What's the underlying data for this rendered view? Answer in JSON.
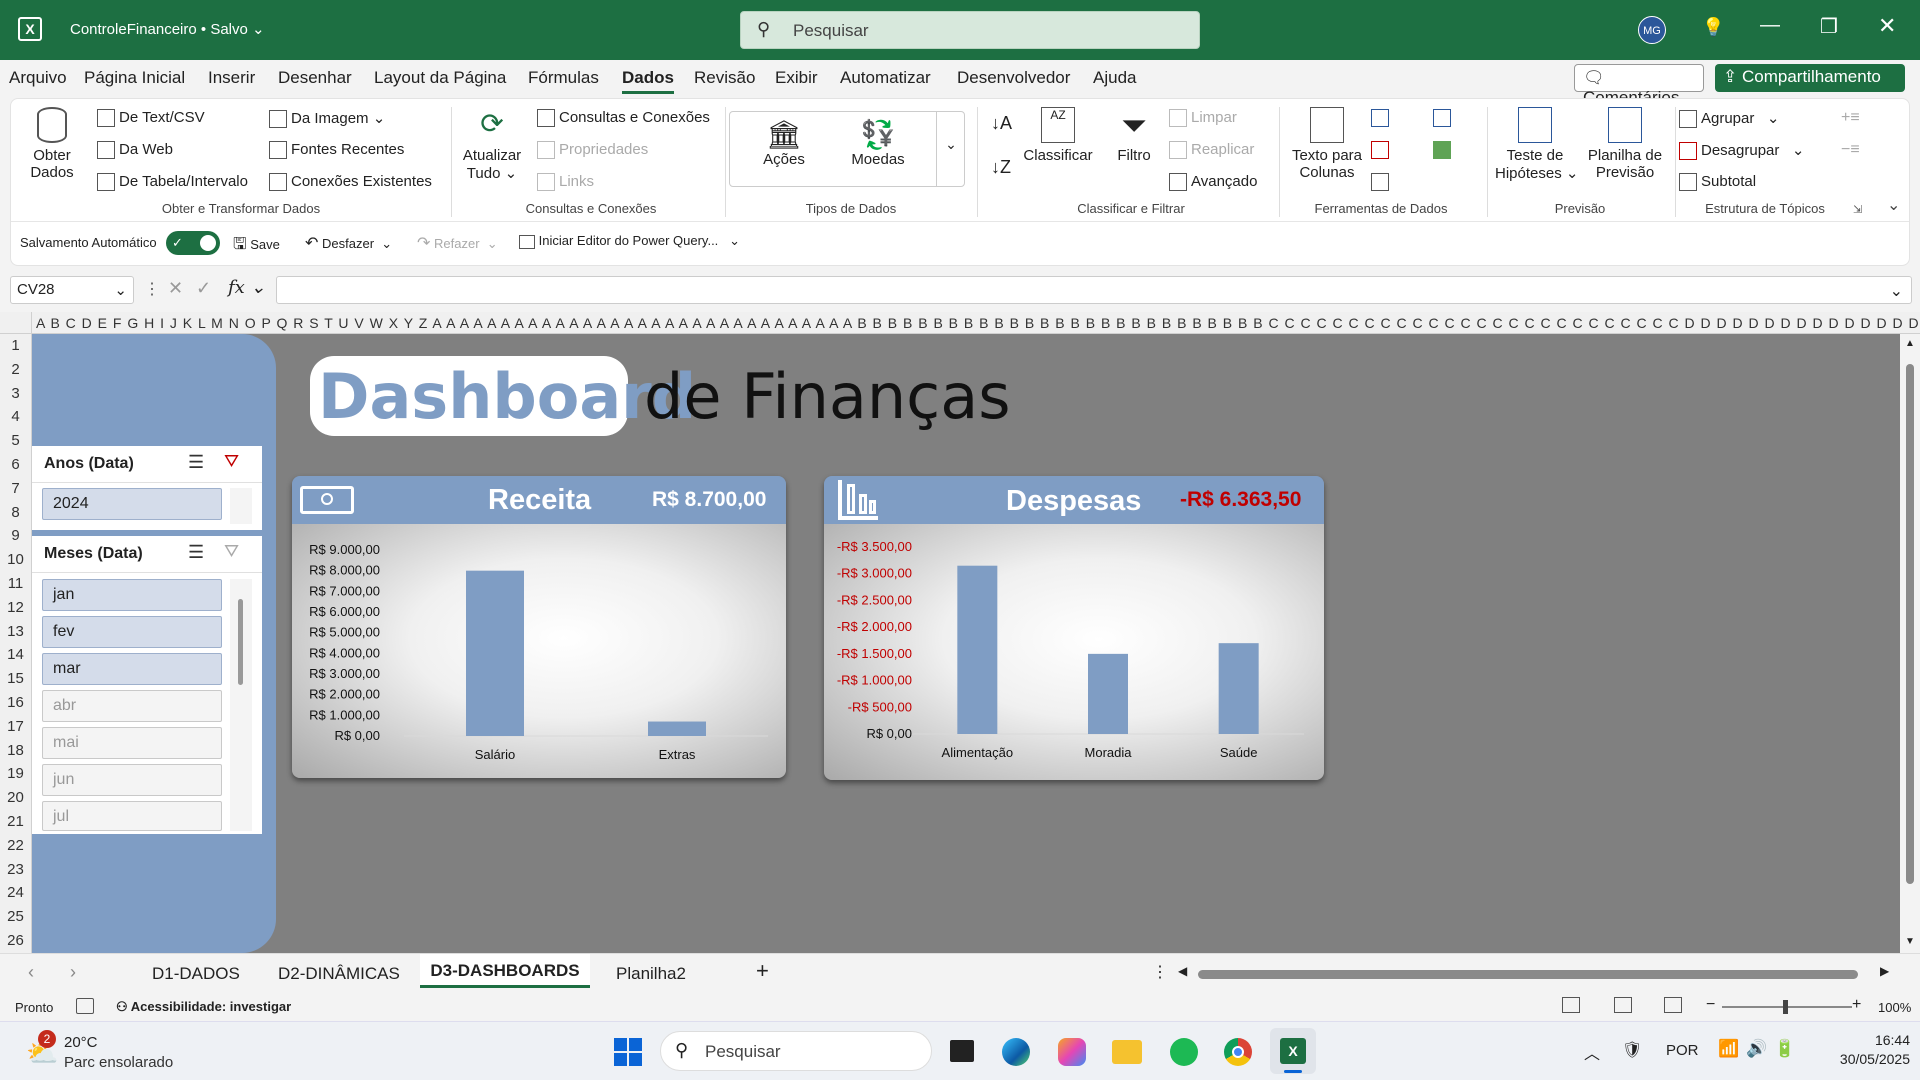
{
  "app": {
    "file_title": "ControleFinanceiro • Salvo",
    "search_placeholder": "Pesquisar",
    "user_initials": "MG"
  },
  "menu": {
    "items": [
      "Arquivo",
      "Página Inicial",
      "Inserir",
      "Desenhar",
      "Layout da Página",
      "Fórmulas",
      "Dados",
      "Revisão",
      "Exibir",
      "Automatizar",
      "Desenvolvedor",
      "Ajuda"
    ],
    "active": "Dados",
    "comments": "Comentários",
    "share": "Compartilhamento"
  },
  "ribbon": {
    "obter_dados": [
      "Obter",
      "Dados"
    ],
    "de_text": "De Text/CSV",
    "da_web": "Da Web",
    "de_tabela": "De Tabela/Intervalo",
    "da_imagem": "Da Imagem",
    "fontes_recentes": "Fontes Recentes",
    "conexoes_existentes": "Conexões Existentes",
    "group_obter": "Obter e Transformar Dados",
    "atualizar": [
      "Atualizar",
      "Tudo"
    ],
    "consultas_conexoes": "Consultas e Conexões",
    "propriedades": "Propriedades",
    "links": "Links",
    "group_consultas": "Consultas e Conexões",
    "acoes": "Ações",
    "moedas": "Moedas",
    "group_tipos": "Tipos de Dados",
    "classificar": "Classificar",
    "filtro": "Filtro",
    "limpar": "Limpar",
    "reaplicar": "Reaplicar",
    "avancado": "Avançado",
    "group_classificar": "Classificar e Filtrar",
    "texto_colunas": [
      "Texto para",
      "Colunas"
    ],
    "group_ferramentas": "Ferramentas de Dados",
    "teste_hipoteses": [
      "Teste de",
      "Hipóteses"
    ],
    "planilha_previsao": [
      "Planilha de",
      "Previsão"
    ],
    "group_previsao": "Previsão",
    "agrupar": "Agrupar",
    "desagrupar": "Desagrupar",
    "subtotal": "Subtotal",
    "group_estrutura": "Estrutura de Tópicos",
    "autosave": "Salvamento Automático",
    "save": "Save",
    "desfazer": "Desfazer",
    "refazer": "Refazer",
    "power_query": "Iniciar Editor do Power Query..."
  },
  "formula_bar": {
    "name_box": "CV28",
    "fx": "fx",
    "formula": ""
  },
  "columns_text": "A B C D E F G H I J K L M N O P Q R S T U V W X Y Z A A A A A A A A A A A A A A A A A A A A A A A A A A A A A A A B B B B B B B B B B B B B B B B B B B B B B B B B B B C C C C C C C C C C C C C C C C C C C C C C C C C C D D D D D D D D D D D D D D D D D D",
  "rows": [
    "1",
    "2",
    "3",
    "4",
    "5",
    "6",
    "7",
    "8",
    "9",
    "10",
    "11",
    "12",
    "13",
    "14",
    "15",
    "16",
    "17",
    "18",
    "19",
    "20",
    "21",
    "22",
    "23",
    "24",
    "25",
    "26"
  ],
  "dashboard": {
    "title_highlight": "Dashboard",
    "title_rest": "de Finanças"
  },
  "slicer_anos": {
    "title": "Anos (Data)",
    "items": [
      {
        "label": "2024",
        "selected": true
      }
    ]
  },
  "slicer_meses": {
    "title": "Meses (Data)",
    "items": [
      {
        "label": "jan",
        "selected": true
      },
      {
        "label": "fev",
        "selected": true
      },
      {
        "label": "mar",
        "selected": true
      },
      {
        "label": "abr",
        "selected": false
      },
      {
        "label": "mai",
        "selected": false
      },
      {
        "label": "jun",
        "selected": false
      },
      {
        "label": "jul",
        "selected": false
      }
    ]
  },
  "chart_data": [
    {
      "type": "bar",
      "title": "Receita",
      "total": "R$ 8.700,00",
      "categories": [
        "Salário",
        "Extras"
      ],
      "values": [
        8000,
        700
      ],
      "ylim": [
        0,
        9000
      ],
      "yticks": [
        "R$ 9.000,00",
        "R$ 8.000,00",
        "R$ 7.000,00",
        "R$ 6.000,00",
        "R$ 5.000,00",
        "R$ 4.000,00",
        "R$ 3.000,00",
        "R$ 2.000,00",
        "R$ 1.000,00",
        "R$ 0,00"
      ],
      "bar_color": "#7f9dc4",
      "grid": false
    },
    {
      "type": "bar",
      "title": "Despesas",
      "total": "-R$ 6.363,50",
      "categories": [
        "Alimentação",
        "Moradia",
        "Saúde"
      ],
      "values": [
        3150,
        1500,
        1700
      ],
      "ylim": [
        0,
        3500
      ],
      "yticks": [
        "-R$ 3.500,00",
        "-R$ 3.000,00",
        "-R$ 2.500,00",
        "-R$ 2.000,00",
        "-R$ 1.500,00",
        "-R$ 1.000,00",
        "-R$ 500,00",
        "R$ 0,00"
      ],
      "bar_color": "#7f9dc4",
      "negative_color": "#c00000",
      "grid": false
    }
  ],
  "sheets": {
    "tabs": [
      "D1-DADOS",
      "D2-DINÂMICAS",
      "D3-DASHBOARDS",
      "Planilha2"
    ],
    "active": "D3-DASHBOARDS"
  },
  "status": {
    "ready": "Pronto",
    "accessibility": "Acessibilidade: investigar",
    "zoom": "100%"
  },
  "taskbar": {
    "weather_temp": "20°C",
    "weather_desc": "Parc ensolarado",
    "weather_badge": "2",
    "search": "Pesquisar",
    "lang": "POR",
    "time": "16:44",
    "date": "30/05/2025"
  }
}
